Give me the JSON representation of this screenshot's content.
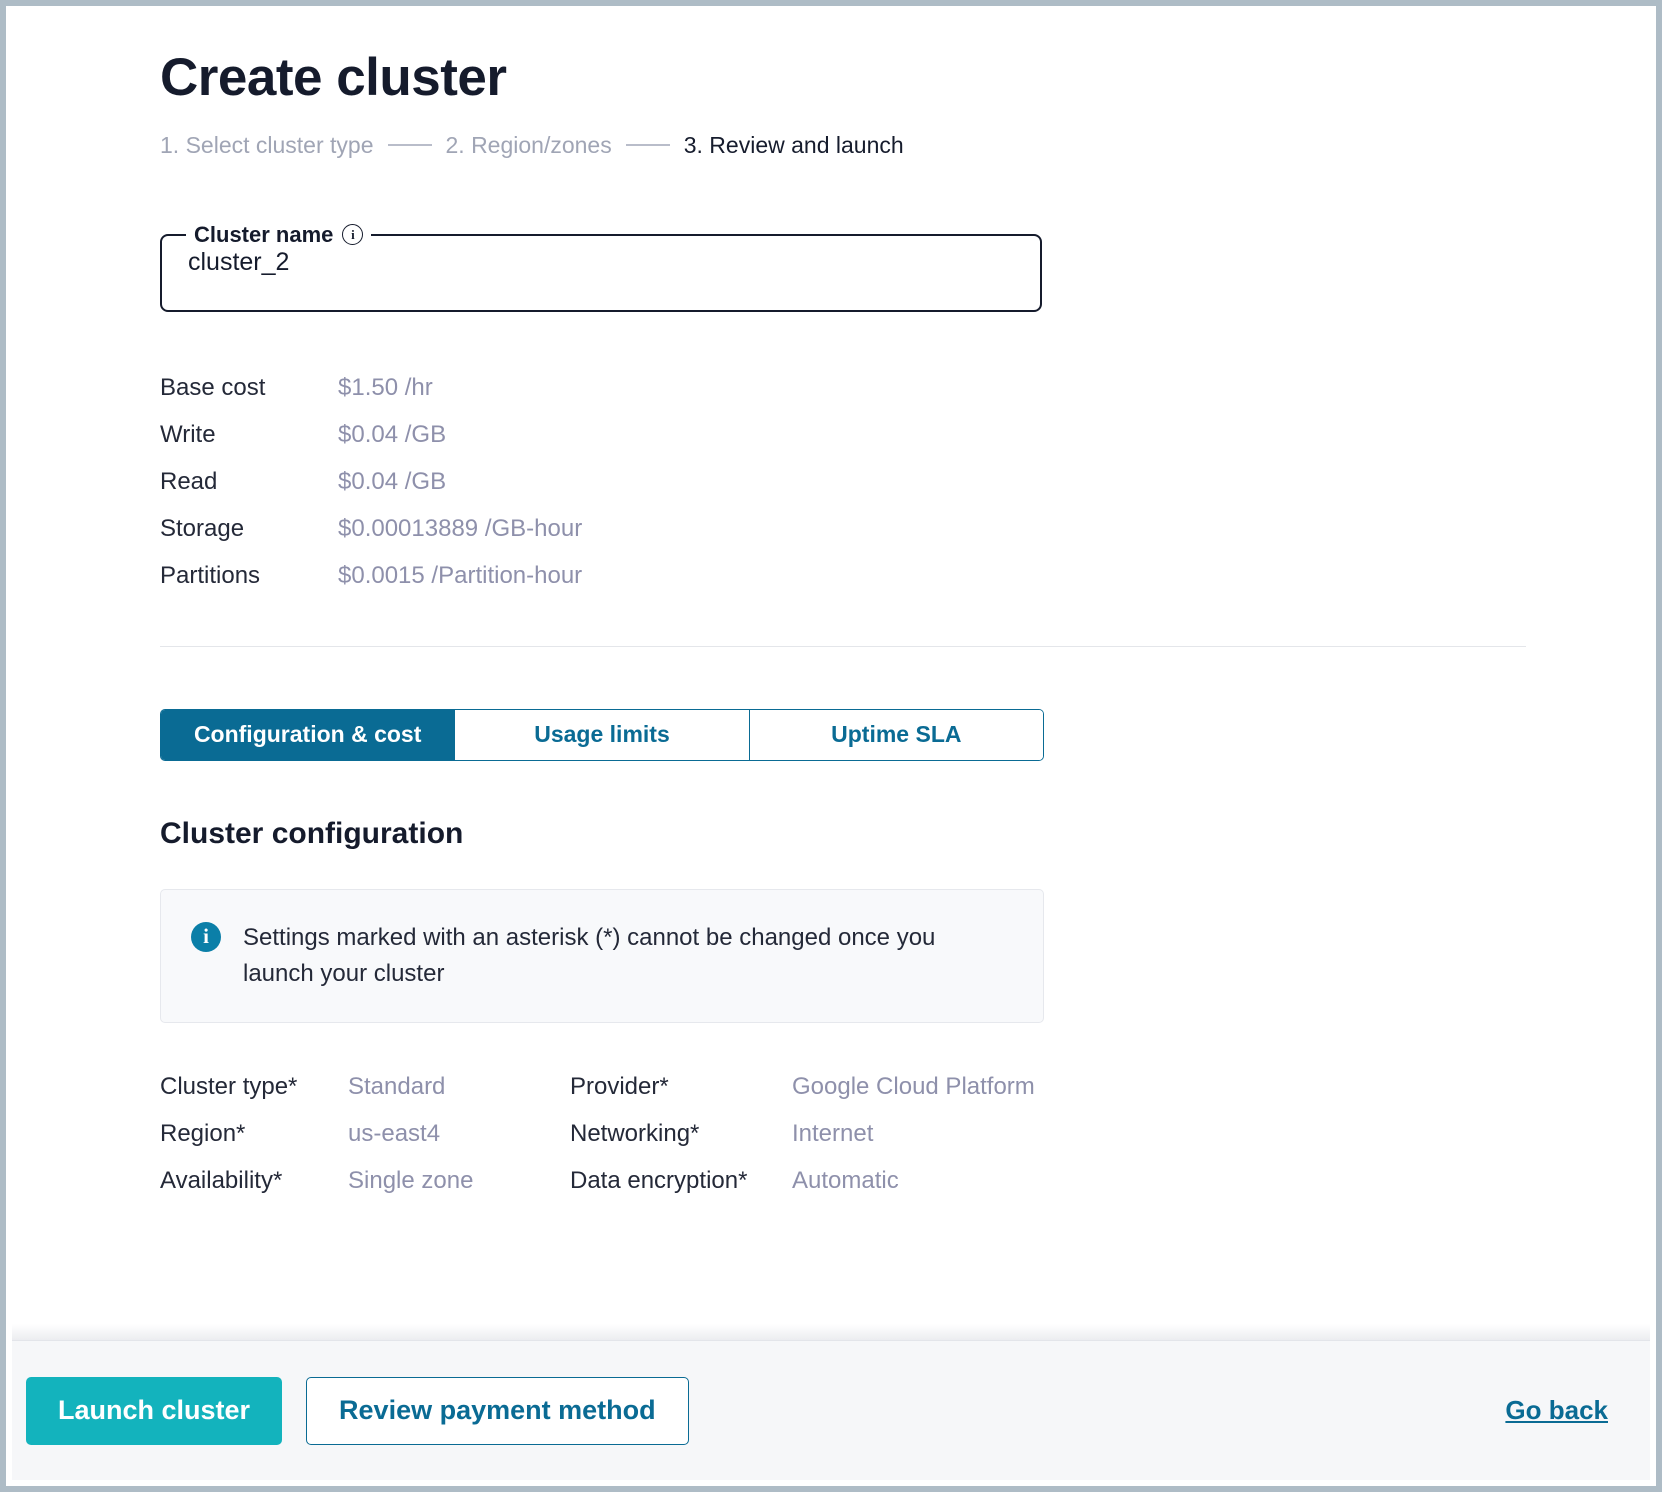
{
  "page": {
    "title": "Create cluster"
  },
  "steps": [
    {
      "label": "1. Select cluster type",
      "state": "done"
    },
    {
      "label": "2. Region/zones",
      "state": "done"
    },
    {
      "label": "3. Review and launch",
      "state": "current"
    }
  ],
  "cluster_name_field": {
    "label": "Cluster name",
    "info_icon": "info-icon",
    "value": "cluster_2",
    "placeholder": "cluster_2"
  },
  "pricing": {
    "rows": [
      {
        "label": "Base cost",
        "value": "$1.50 /hr"
      },
      {
        "label": "Write",
        "value": "$0.04 /GB"
      },
      {
        "label": "Read",
        "value": "$0.04 /GB"
      },
      {
        "label": "Storage",
        "value": "$0.00013889 /GB-hour"
      },
      {
        "label": "Partitions",
        "value": "$0.0015 /Partition-hour"
      }
    ]
  },
  "tabs": [
    {
      "label": "Configuration & cost",
      "active": true
    },
    {
      "label": "Usage limits",
      "active": false
    },
    {
      "label": "Uptime SLA",
      "active": false
    }
  ],
  "section": {
    "title": "Cluster configuration",
    "notice": {
      "icon": "info-filled-icon",
      "text": "Settings marked with an asterisk (*) cannot be changed once you launch your cluster"
    }
  },
  "configuration": {
    "rows": [
      {
        "left_label": "Cluster type*",
        "left_value": "Standard",
        "right_label": "Provider*",
        "right_value": "Google Cloud Platform"
      },
      {
        "left_label": "Region*",
        "left_value": "us-east4",
        "right_label": "Networking*",
        "right_value": "Internet"
      },
      {
        "left_label": "Availability*",
        "left_value": "Single zone",
        "right_label": "Data encryption*",
        "right_value": "Automatic"
      }
    ]
  },
  "footer": {
    "primary_label": "Launch cluster",
    "secondary_label": "Review payment method",
    "back_label": "Go back"
  },
  "colors": {
    "accent_teal": "#13b3bd",
    "accent_blue": "#0a6b94",
    "info_blue": "#0b7fa8",
    "text_dark": "#151b2c",
    "text_muted": "#8e90ab",
    "footer_bg": "#f6f7f9"
  }
}
